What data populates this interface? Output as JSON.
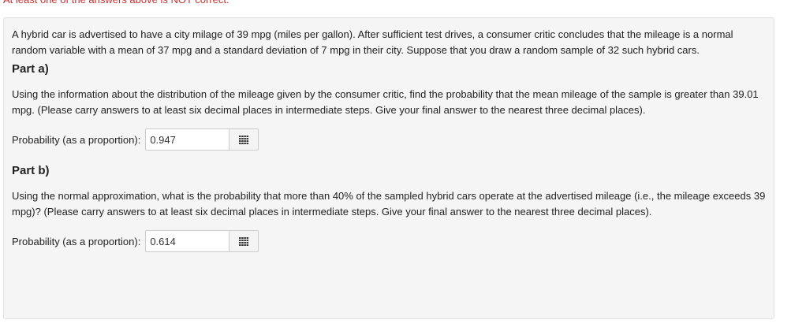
{
  "warning": "At least one of the answers above is NOT correct.",
  "problem": {
    "intro": "A hybrid car is advertised to have a city milage of 39 mpg (miles per gallon). After sufficient test drives, a consumer critic concludes that the mileage is a normal random variable with a mean of 37 mpg and a standard deviation of 7 mpg in their city. Suppose that you draw a random sample of 32 such hybrid cars.",
    "parts": [
      {
        "heading": "Part a)",
        "text": "Using the information about the distribution of the mileage given by the consumer critic, find the probability that the mean mileage of the sample is greater than 39.01 mpg. (Please carry answers to at least six decimal places in intermediate steps. Give your final answer to the nearest three decimal places).",
        "answer_label": "Probability (as a proportion):",
        "answer_value": "0.947"
      },
      {
        "heading": "Part b)",
        "text": "Using the normal approximation, what is the probability that more than 40% of the sampled hybrid cars operate at the advertised mileage (i.e., the mileage exceeds 39 mpg)? (Please carry answers to at least six decimal places in intermediate steps. Give your final answer to the nearest three decimal places).",
        "answer_label": "Probability (as a proportion):",
        "answer_value": "0.614"
      }
    ]
  },
  "icons": {
    "answer_addon": "grid-icon"
  },
  "colors": {
    "warning": "#c7302e",
    "panel_bg": "#f5f5f5",
    "panel_border": "#e0e0e0",
    "text": "#222222"
  }
}
